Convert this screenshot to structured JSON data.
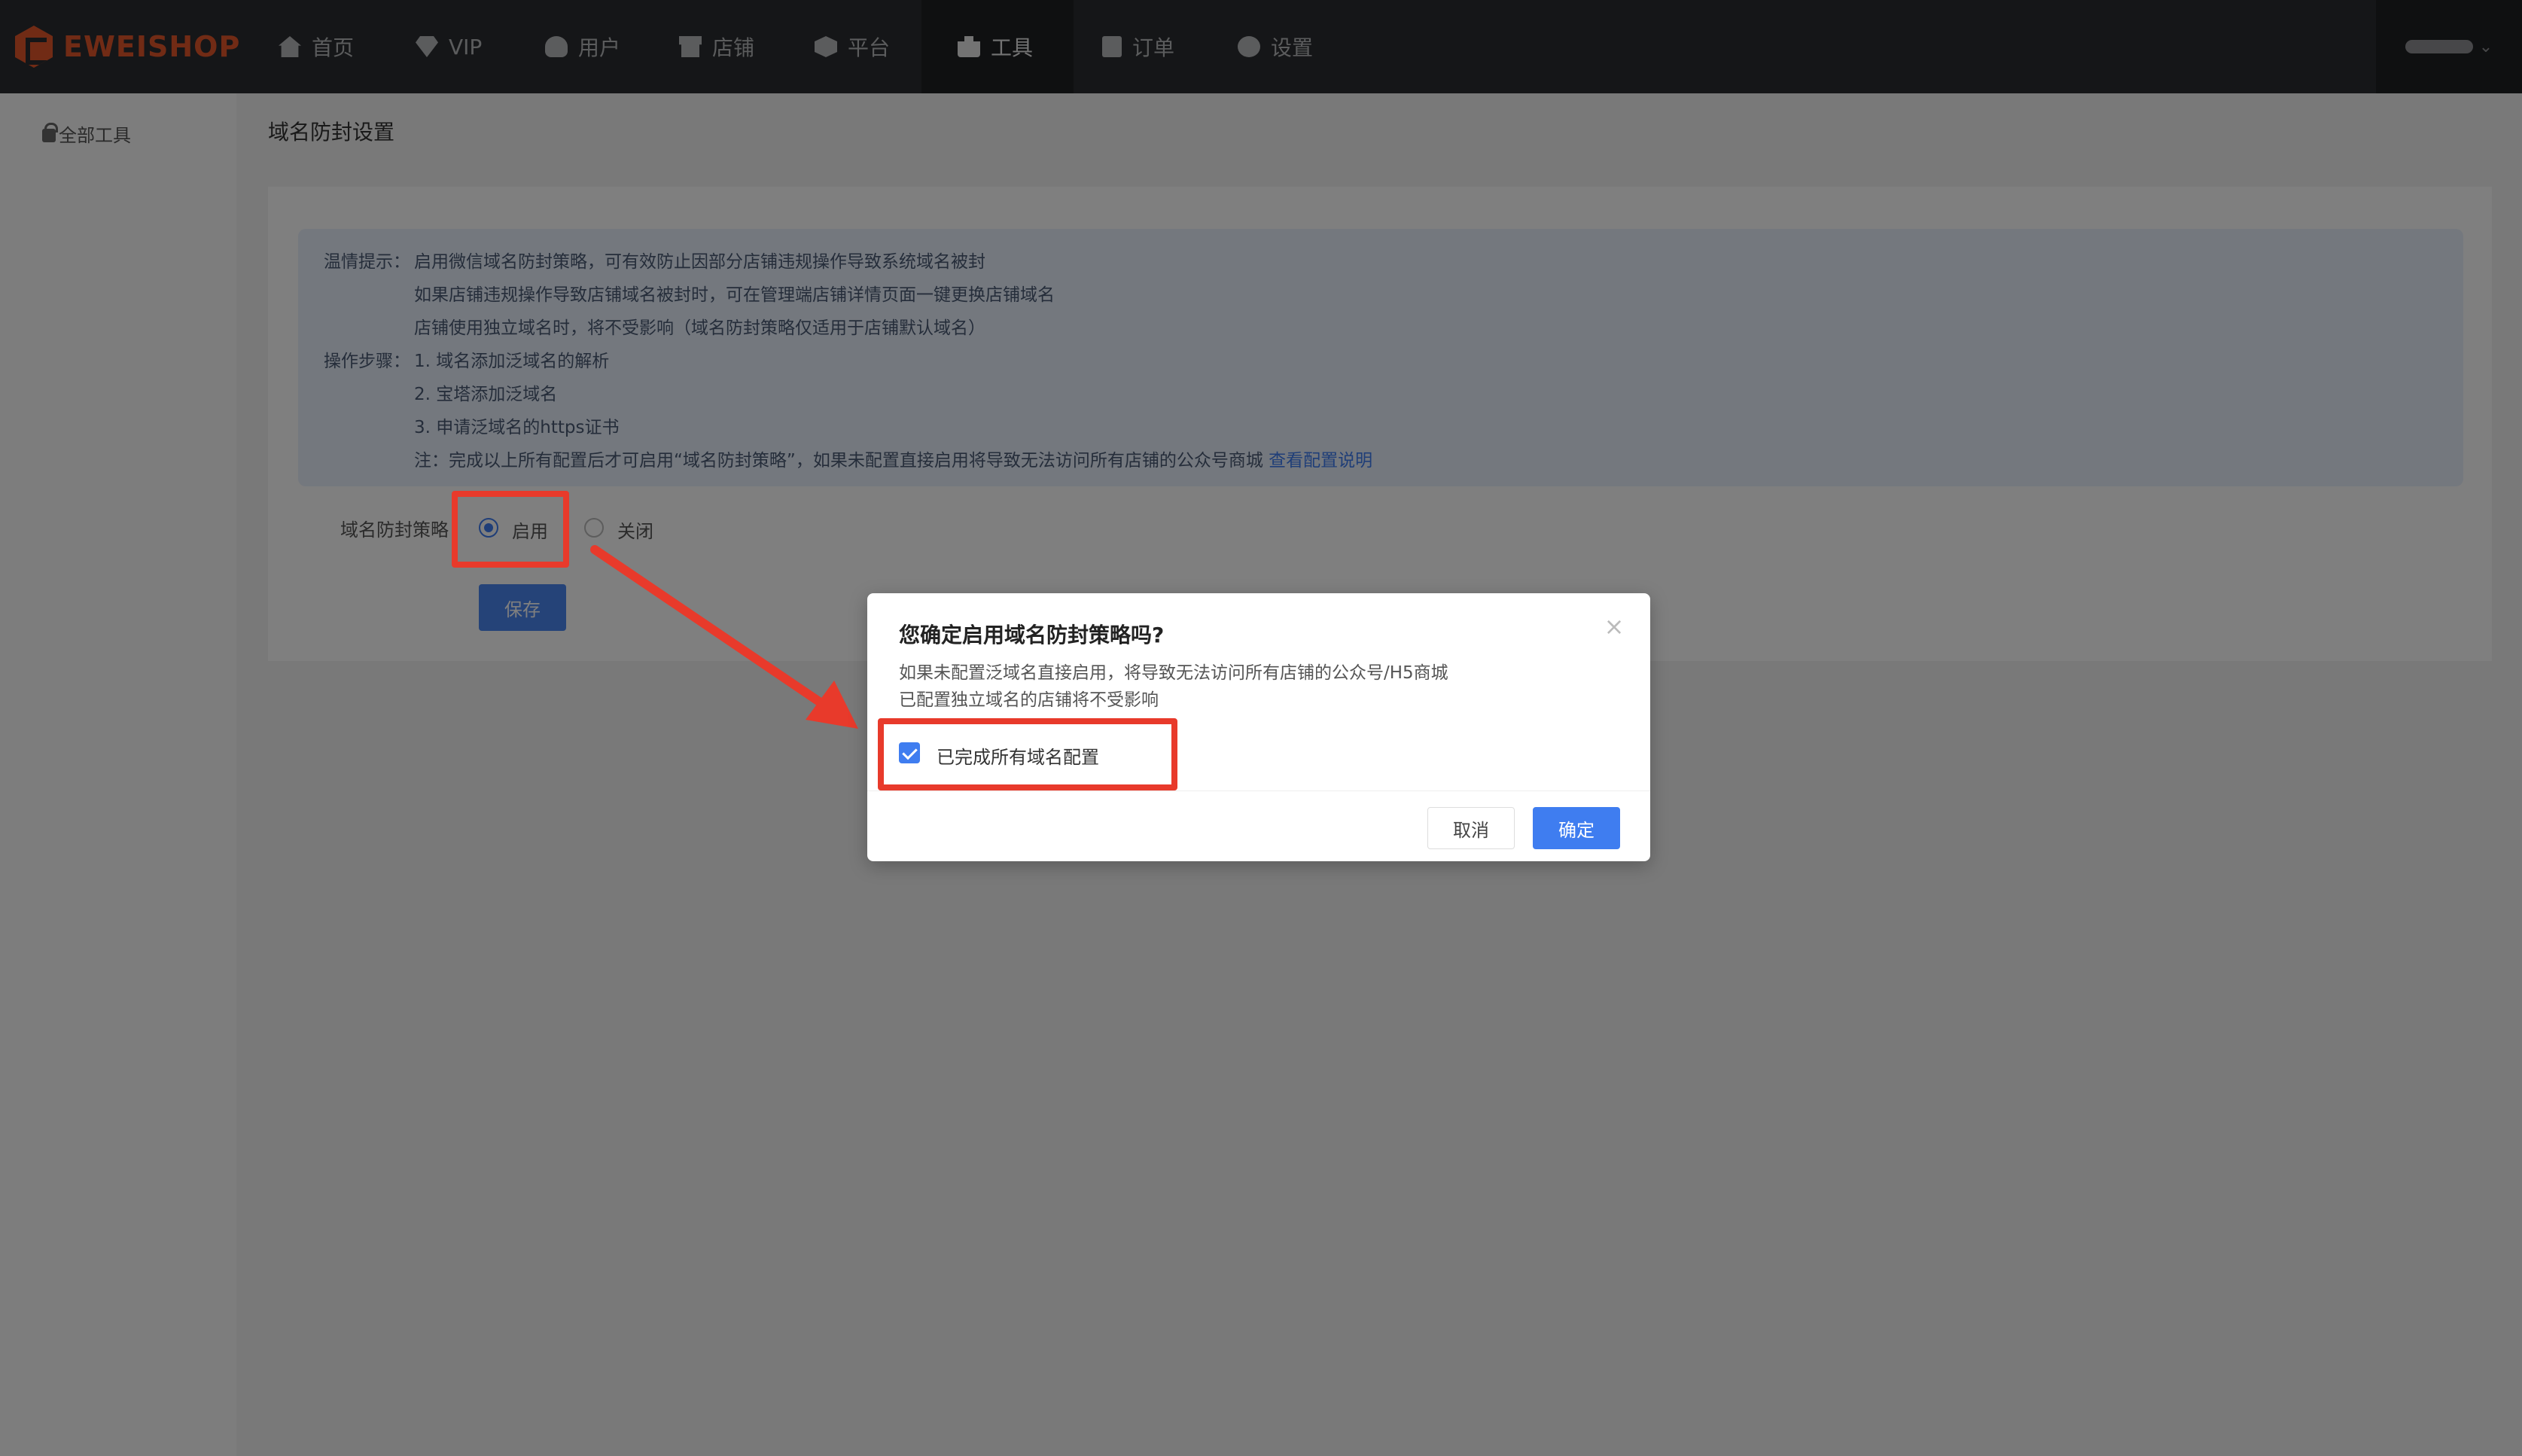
{
  "brand": {
    "logo_text": "EWEISHOP",
    "accent_color": "#e2572b"
  },
  "nav": {
    "items": [
      {
        "label": "首页",
        "icon": "home-icon"
      },
      {
        "label": "VIP",
        "icon": "diamond-icon"
      },
      {
        "label": "用户",
        "icon": "user-icon"
      },
      {
        "label": "店铺",
        "icon": "store-icon"
      },
      {
        "label": "平台",
        "icon": "platform-icon"
      },
      {
        "label": "工具",
        "icon": "toolbox-icon",
        "active": true
      },
      {
        "label": "订单",
        "icon": "order-icon"
      },
      {
        "label": "设置",
        "icon": "gear-icon"
      }
    ]
  },
  "sidebar": {
    "items": [
      {
        "label": "全部工具",
        "icon": "lock-icon"
      }
    ]
  },
  "page": {
    "title": "域名防封设置",
    "notice": {
      "tip_label": "温情提示：",
      "tip_lines": [
        "启用微信域名防封策略，可有效防止因部分店铺违规操作导致系统域名被封",
        "如果店铺违规操作导致店铺域名被封时，可在管理端店铺详情页面一键更换店铺域名",
        "店铺使用独立域名时，将不受影响（域名防封策略仅适用于店铺默认域名）"
      ],
      "steps_label": "操作步骤：",
      "steps": [
        "1. 域名添加泛域名的解析",
        "2. 宝塔添加泛域名",
        "3. 申请泛域名的https证书"
      ],
      "note_text": "注：完成以上所有配置后才可启用“域名防封策略”，如果未配置直接启用将导致无法访问所有店铺的公众号商城",
      "note_link": "查看配置说明"
    },
    "form": {
      "label": "域名防封策略",
      "options": [
        {
          "label": "启用",
          "selected": true
        },
        {
          "label": "关闭",
          "selected": false
        }
      ],
      "save_label": "保存"
    }
  },
  "dialog": {
    "title": "您确定启用域名防封策略吗?",
    "messages": [
      "如果未配置泛域名直接启用，将导致无法访问所有店铺的公众号/H5商城",
      "已配置独立域名的店铺将不受影响"
    ],
    "checkbox": {
      "label": "已完成所有域名配置",
      "checked": true
    },
    "cancel_label": "取消",
    "ok_label": "确定",
    "close_icon": "close-icon"
  },
  "colors": {
    "primary": "#3f7df0",
    "annotation": "#e83a2b"
  }
}
